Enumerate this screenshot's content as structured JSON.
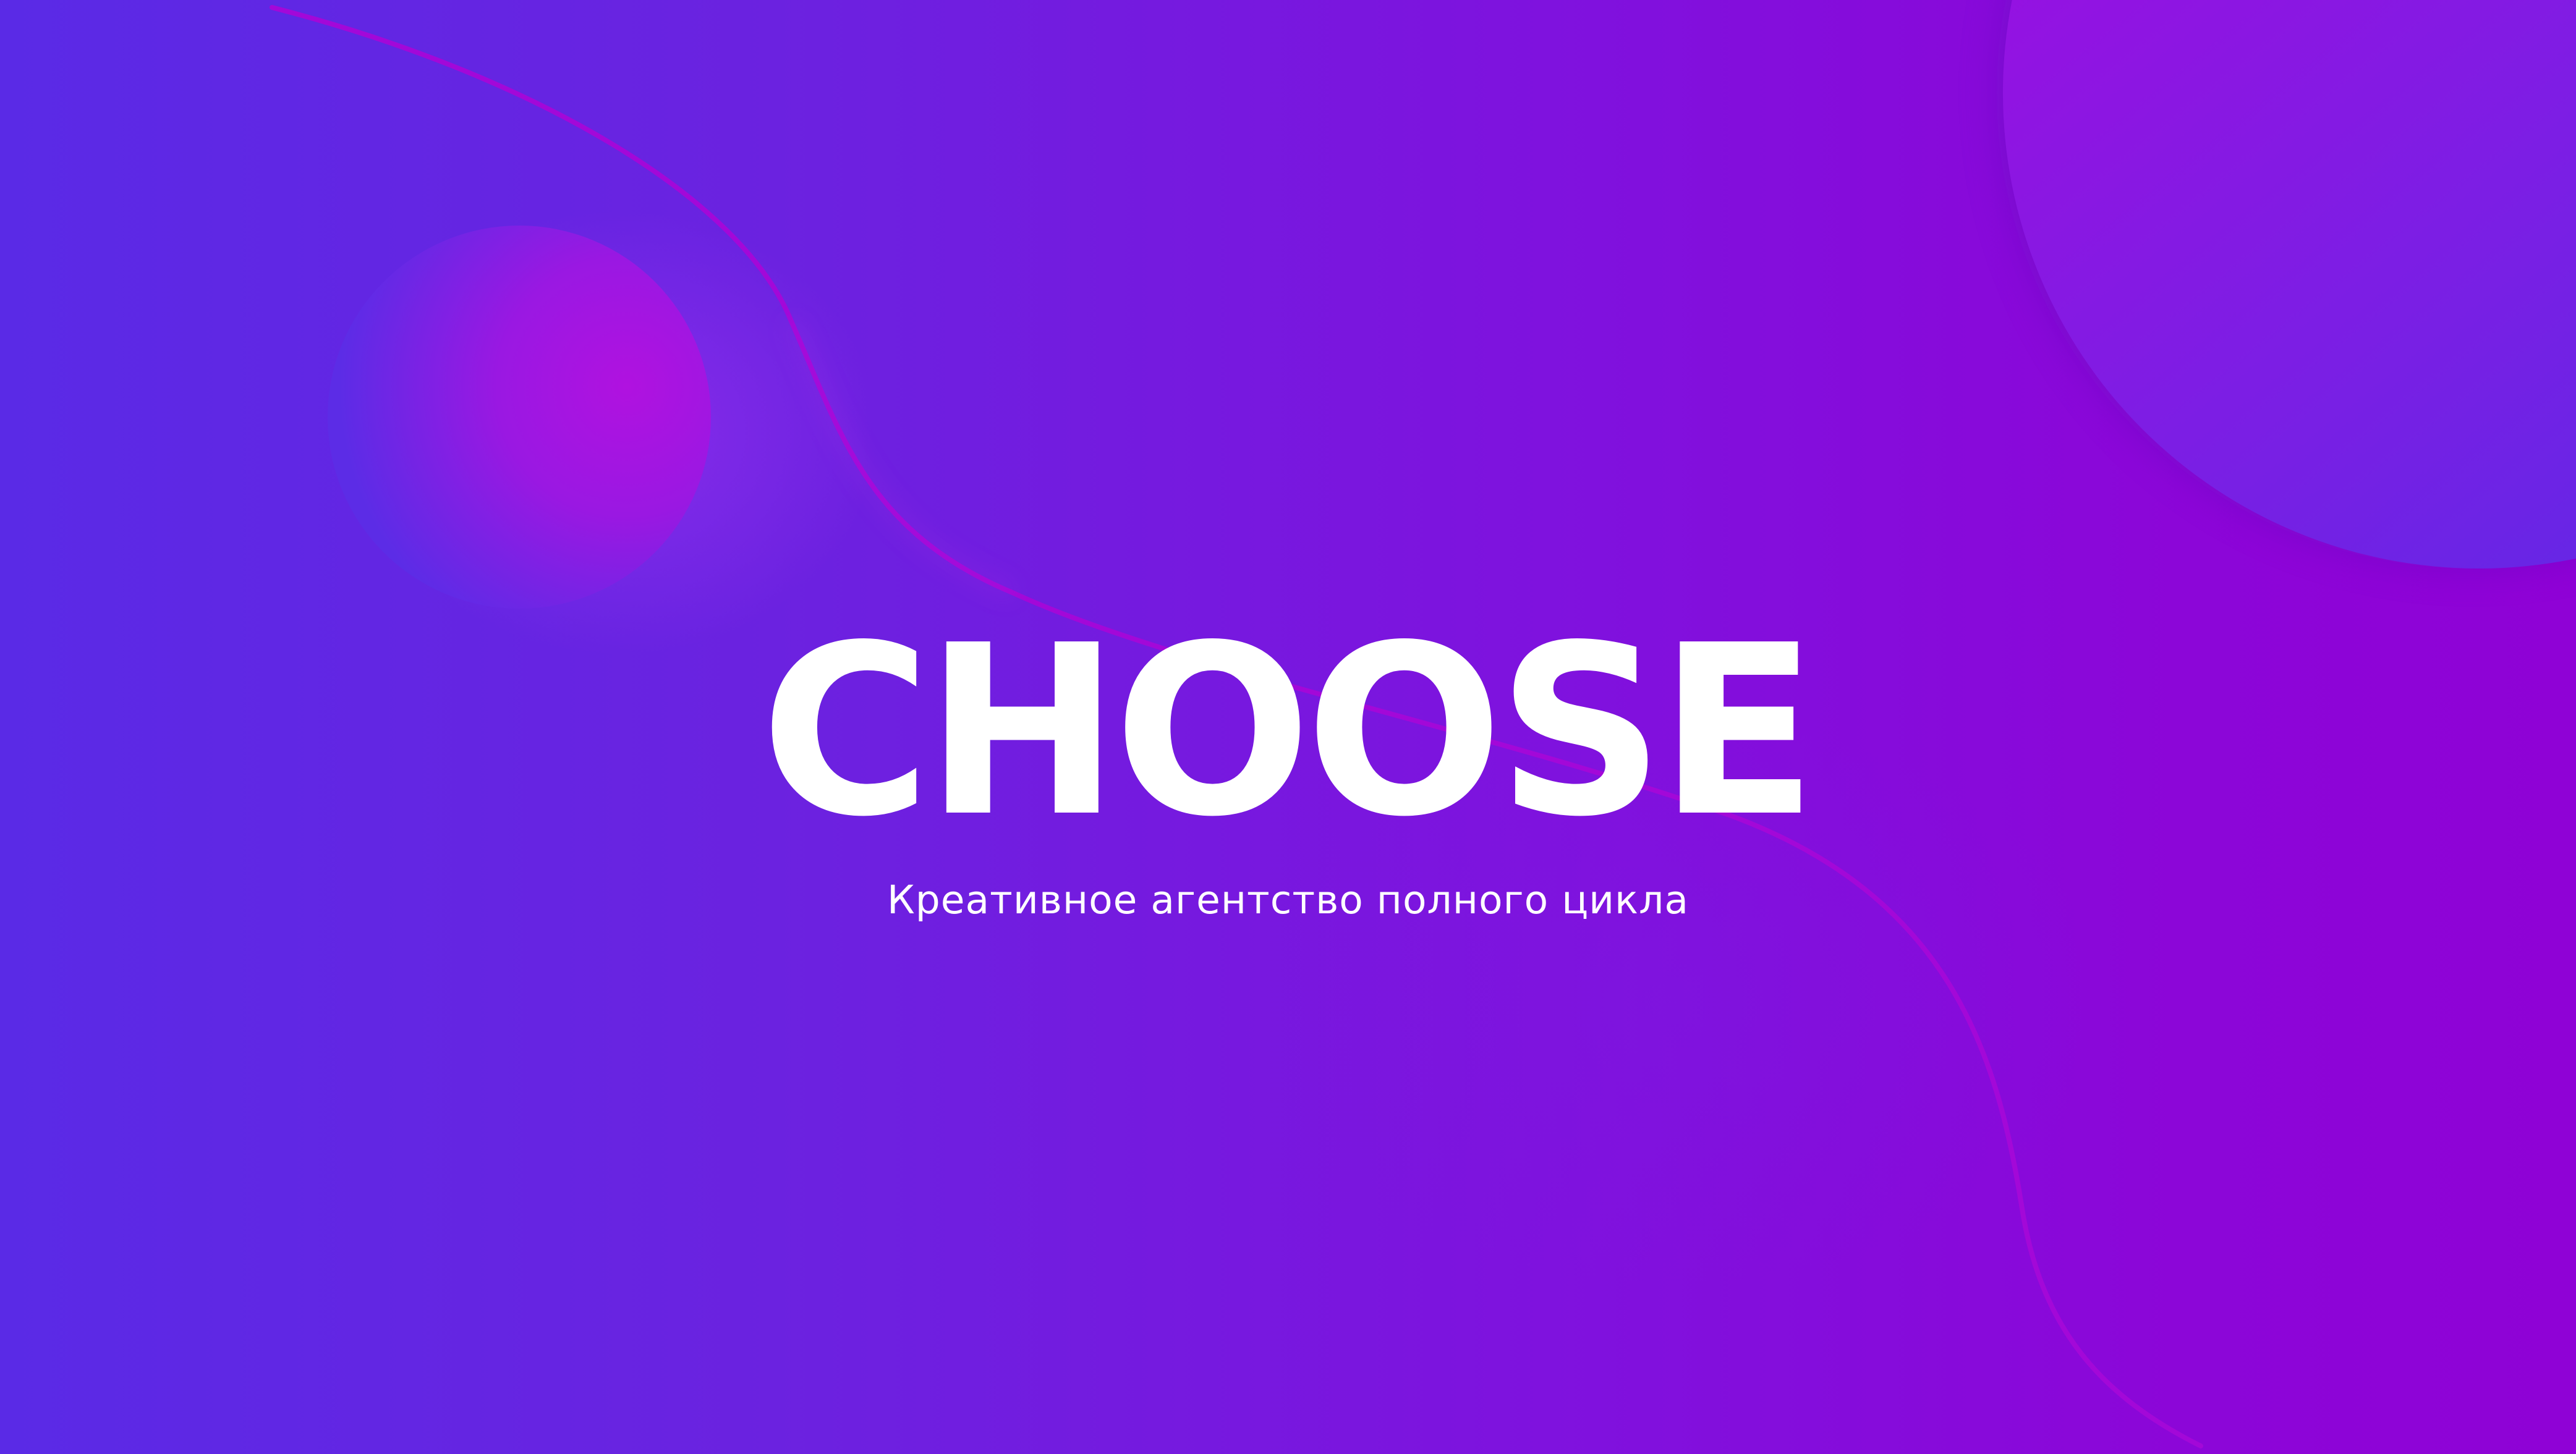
{
  "brand": {
    "logo_text": "CHOOSE",
    "tagline": "Креативное агентство полного цикла"
  },
  "colors": {
    "background_start": "#5a2ae6",
    "background_end": "#8f02d6",
    "accent_magenta": "#a10ce0",
    "logo": "#ffffff"
  },
  "decor": {
    "shapes": [
      "left-sphere",
      "top-right-circle",
      "curved-line",
      "soft-blob"
    ]
  }
}
